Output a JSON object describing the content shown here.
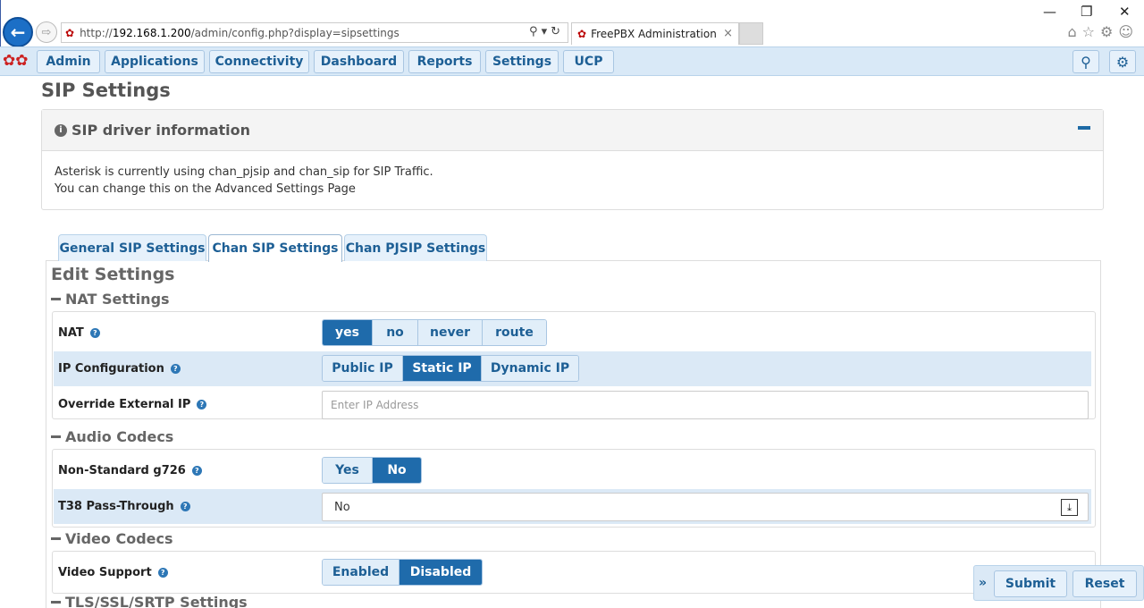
{
  "browser": {
    "url_prefix": "http://",
    "url_host": "192.168.1.200",
    "url_path": "/admin/config.php?display=sipsettings",
    "tab_title": "FreePBX Administration"
  },
  "nav": {
    "items": [
      "Admin",
      "Applications",
      "Connectivity",
      "Dashboard",
      "Reports",
      "Settings",
      "UCP"
    ]
  },
  "page": {
    "title": "SIP Settings"
  },
  "driver_info": {
    "title": "SIP driver information",
    "line1": "Asterisk is currently using chan_pjsip and chan_sip for SIP Traffic.",
    "line2": "You can change this on the Advanced Settings Page"
  },
  "tabs": [
    "General SIP Settings",
    "Chan SIP Settings",
    "Chan PJSIP Settings"
  ],
  "active_tab": "Chan SIP Settings",
  "edit_title": "Edit Settings",
  "nat_section": {
    "title": "NAT Settings",
    "nat": {
      "label": "NAT",
      "options": [
        "yes",
        "no",
        "never",
        "route"
      ],
      "selected": "yes"
    },
    "ip_config": {
      "label": "IP Configuration",
      "options": [
        "Public IP",
        "Static IP",
        "Dynamic IP"
      ],
      "selected": "Static IP"
    },
    "override_ip": {
      "label": "Override External IP",
      "placeholder": "Enter IP Address",
      "value": ""
    }
  },
  "audio_section": {
    "title": "Audio Codecs",
    "g726": {
      "label": "Non-Standard g726",
      "options": [
        "Yes",
        "No"
      ],
      "selected": "No"
    },
    "t38": {
      "label": "T38 Pass-Through",
      "value": "No"
    }
  },
  "video_section": {
    "title": "Video Codecs",
    "support": {
      "label": "Video Support",
      "options": [
        "Enabled",
        "Disabled"
      ],
      "selected": "Disabled"
    }
  },
  "tls_section": {
    "title": "TLS/SSL/SRTP Settings"
  },
  "actions": {
    "submit": "Submit",
    "reset": "Reset"
  }
}
